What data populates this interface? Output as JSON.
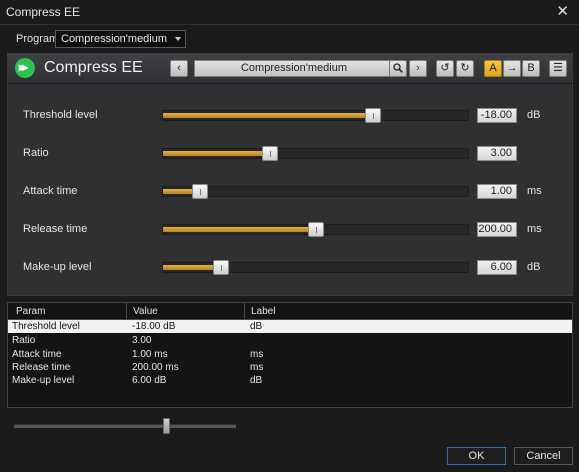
{
  "window": {
    "title": "Compress EE"
  },
  "program": {
    "label": "Program",
    "value": "Compression'medium"
  },
  "plugin": {
    "title": "Compress EE",
    "preset": "Compression'medium",
    "buttons": {
      "a": "A",
      "arrow": "→",
      "b": "B"
    }
  },
  "params": [
    {
      "label": "Threshold level",
      "value": "-18.00",
      "unit": "dB",
      "level": 0.69
    },
    {
      "label": "Ratio",
      "value": "3.00",
      "unit": "",
      "level": 0.35
    },
    {
      "label": "Attack time",
      "value": "1.00",
      "unit": "ms",
      "level": 0.12
    },
    {
      "label": "Release time",
      "value": "200.00",
      "unit": "ms",
      "level": 0.5
    },
    {
      "label": "Make-up level",
      "value": "6.00",
      "unit": "dB",
      "level": 0.19
    }
  ],
  "table": {
    "columns": [
      "Param",
      "Value",
      "Label"
    ],
    "rows": [
      {
        "param": "Threshold level",
        "value": "-18.00 dB",
        "label": "dB"
      },
      {
        "param": "Ratio",
        "value": "3.00",
        "label": ""
      },
      {
        "param": "Attack time",
        "value": "1.00 ms",
        "label": "ms"
      },
      {
        "param": "Release time",
        "value": "200.00 ms",
        "label": "ms"
      },
      {
        "param": "Make-up level",
        "value": "6.00 dB",
        "label": "dB"
      }
    ]
  },
  "bottom_slider": {
    "level": 0.68
  },
  "dialog": {
    "ok": "OK",
    "cancel": "Cancel"
  },
  "icons": {
    "close": "close-icon",
    "logo": "play-forward-icon",
    "prev": "chevron-left-icon",
    "search": "search-icon",
    "next": "chevron-right-icon",
    "undo": "undo-icon",
    "redo": "redo-icon",
    "menu": "hamburger-menu-icon"
  },
  "colors": {
    "accent": "#d8a32a",
    "logo": "#2fc24f",
    "ok_border": "#2f6fae"
  }
}
